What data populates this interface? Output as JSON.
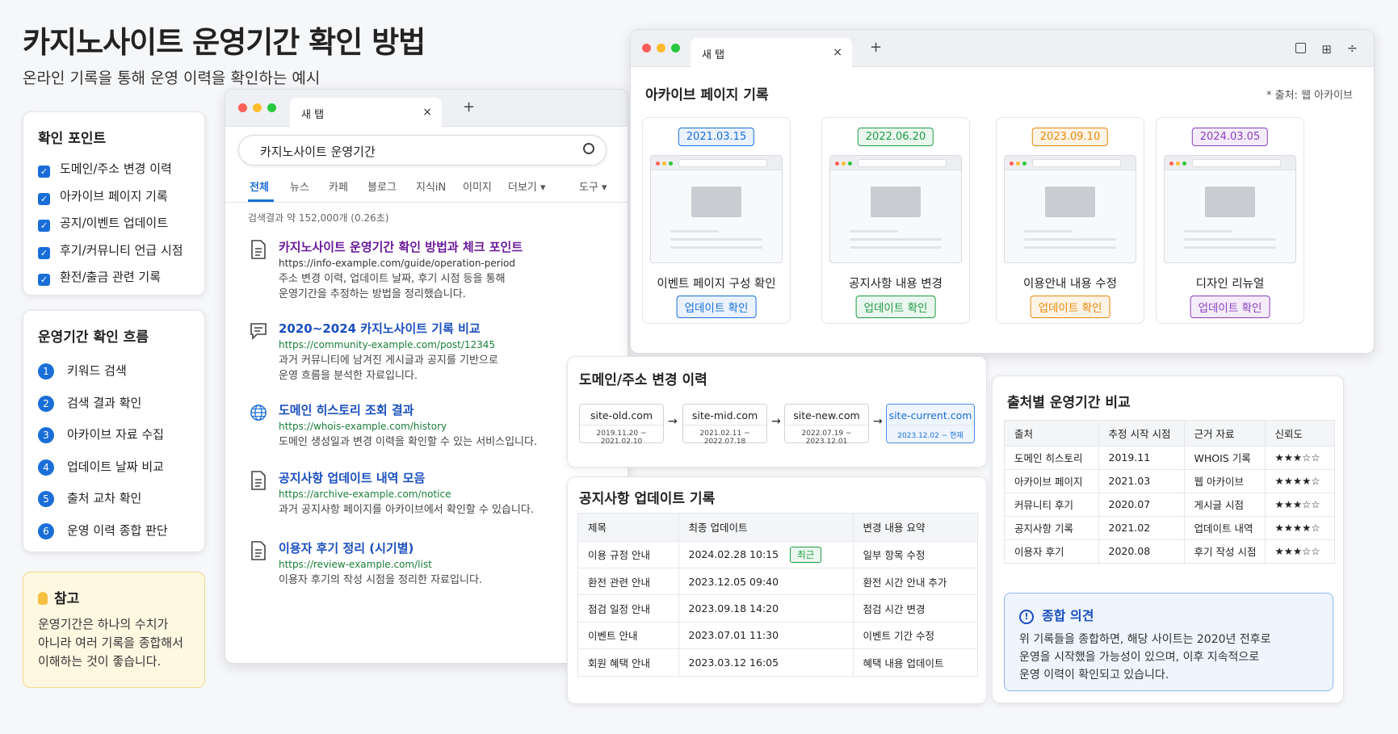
{
  "page": {
    "title": "카지노사이트 운영기간 확인 방법",
    "subtitle": "온라인 기록을 통해 운영 이력을 확인하는 예시"
  },
  "checkpoints": {
    "title": "확인 포인트",
    "items": [
      "도메인/주소 변경 이력",
      "아카이브 페이지 기록",
      "공지/이벤트 업데이트",
      "후기/커뮤니티 언급 시점",
      "환전/출금 관련 기록"
    ]
  },
  "flow": {
    "title": "운영기간 확인 흐름",
    "steps": [
      {
        "num": "1",
        "label": "키워드 검색"
      },
      {
        "num": "2",
        "label": "검색 결과 확인"
      },
      {
        "num": "3",
        "label": "아카이브 자료 수집"
      },
      {
        "num": "4",
        "label": "업데이트 날짜 비교"
      },
      {
        "num": "5",
        "label": "출처 교차 확인"
      },
      {
        "num": "6",
        "label": "운영 이력 종합 판단"
      }
    ]
  },
  "note": {
    "title": "참고",
    "body": "운영기간은 하나의 수치가 아니라 여러 기록을 종합해서 이해하는 것이 좋습니다.",
    "lines": [
      "운영기간은 하나의 수치가",
      "아니라 여러 기록을 종합해서",
      "이해하는 것이 좋습니다."
    ]
  },
  "search_window": {
    "tab_label": "새 탭",
    "query": "카지노사이트 운영기간",
    "tabs": [
      "전체",
      "뉴스",
      "카페",
      "블로그",
      "지식iN",
      "이미지",
      "더보기 ▾",
      "도구 ▾"
    ],
    "result_count": "검색결과 약 152,000개 (0.26초)",
    "results": [
      {
        "icon": "document-icon",
        "title": "카지노사이트 운영기간 확인 방법과 체크 포인트",
        "url": "https://info-example.com/guide/operation-period",
        "desc": [
          "주소 변경 이력, 업데이트 날짜, 후기 시점 등을 통해",
          "운영기간을 추정하는 방법을 정리했습니다."
        ]
      },
      {
        "icon": "chat-icon",
        "title": "2020~2024 카지노사이트 기록 비교",
        "url": "https://community-example.com/post/12345",
        "desc": [
          "과거 커뮤니티에 남겨진 게시글과 공지를 기반으로",
          "운영 흐름을 분석한 자료입니다."
        ]
      },
      {
        "icon": "globe-icon",
        "title": "도메인 히스토리 조회 결과",
        "url": "https://whois-example.com/history",
        "desc": [
          "도메인 생성일과 변경 이력을 확인할 수 있는 서비스입니다."
        ]
      },
      {
        "icon": "document-icon",
        "title": "공지사항 업데이트 내역 모음",
        "url": "https://archive-example.com/notice",
        "desc": [
          "과거 공지사항 페이지를 아카이브에서 확인할 수 있습니다."
        ]
      },
      {
        "icon": "document-icon",
        "title": "이용자 후기 정리 (시기별)",
        "url": "https://review-example.com/list",
        "desc": [
          "이용자 후기의 작성 시점을 정리한 자료입니다."
        ]
      }
    ]
  },
  "archive_window": {
    "tab_label": "새 탭",
    "title": "아카이브 페이지 기록",
    "source": "* 출처: 웹 아카이브",
    "snapshots": [
      {
        "date": "2021.03.15",
        "caption": "이벤트 페이지 구성 확인",
        "button": "업데이트 확인",
        "color": "#1a6ed8",
        "bg": "#eaf2fd"
      },
      {
        "date": "2022.06.20",
        "caption": "공지사항 내용 변경",
        "button": "업데이트 확인",
        "color": "#1f9a45",
        "bg": "#eaf7ee"
      },
      {
        "date": "2023.09.10",
        "caption": "이용안내 내용 수정",
        "button": "업데이트 확인",
        "color": "#e8890c",
        "bg": "#fdf3e4"
      },
      {
        "date": "2024.03.05",
        "caption": "디자인 리뉴얼",
        "button": "업데이트 확인",
        "color": "#8a3fbf",
        "bg": "#f4ecfa"
      }
    ]
  },
  "domain_history": {
    "title": "도메인/주소 변경 이력",
    "domains": [
      {
        "name": "site-old.com",
        "range": "2019.11.20 ~ 2021.02.10"
      },
      {
        "name": "site-mid.com",
        "range": "2021.02.11 ~ 2022.07.18"
      },
      {
        "name": "site-new.com",
        "range": "2022.07.19 ~ 2023.12.01"
      },
      {
        "name": "site-current.com",
        "range": "2023.12.02 ~ 현재"
      }
    ]
  },
  "notice_updates": {
    "title": "공지사항 업데이트 기록",
    "headers": [
      "제목",
      "최종 업데이트",
      "변경 내용 요약"
    ],
    "recent_badge": "최근",
    "rows": [
      [
        "이용 규정 안내",
        "2024.02.28 10:15",
        "일부 항목 수정"
      ],
      [
        "환전 관련 안내",
        "2023.12.05 09:40",
        "환전 시간 안내 추가"
      ],
      [
        "점검 일정 안내",
        "2023.09.18 14:20",
        "점검 시간 변경"
      ],
      [
        "이벤트 안내",
        "2023.07.01 11:30",
        "이벤트 기간 수정"
      ],
      [
        "회원 혜택 안내",
        "2023.03.12 16:05",
        "혜택 내용 업데이트"
      ]
    ]
  },
  "source_compare": {
    "title": "출처별 운영기간 비교",
    "headers": [
      "출처",
      "추정 시작 시점",
      "근거 자료",
      "신뢰도"
    ],
    "rows": [
      [
        "도메인 히스토리",
        "2019.11",
        "WHOIS 기록",
        "★★★☆☆"
      ],
      [
        "아카이브 페이지",
        "2021.03",
        "웹 아카이브",
        "★★★★☆"
      ],
      [
        "커뮤니티 후기",
        "2020.07",
        "게시글 시점",
        "★★★☆☆"
      ],
      [
        "공지사항 기록",
        "2021.02",
        "업데이트 내역",
        "★★★★☆"
      ],
      [
        "이용자 후기",
        "2020.08",
        "후기 작성 시점",
        "★★★☆☆"
      ]
    ],
    "opinion_title": "종합 의견",
    "opinion_lines": [
      "위 기록들을 종합하면, 해당 사이트는 2020년 전후로",
      "운영을 시작했을 가능성이 있으며, 이후 지속적으로",
      "운영 이력이 확인되고 있습니다."
    ]
  },
  "colors": {
    "accent": "#1a6ed8",
    "link": "#1a4fbf",
    "visited": "#6a1b9a",
    "url_green": "#1a7f3a"
  }
}
